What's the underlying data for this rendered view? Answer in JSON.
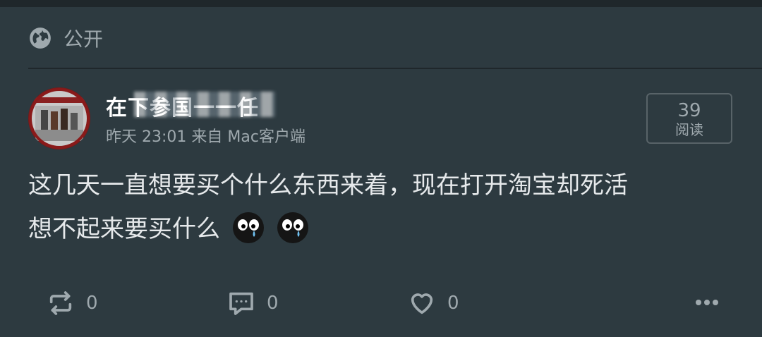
{
  "visibility": {
    "icon": "globe-icon",
    "label": "公开"
  },
  "post": {
    "author_name": "在下参国一一任",
    "meta": "昨天 23:01 来自 Mac客户端",
    "read_count": "39",
    "read_label": "阅读",
    "content_line1": "这几天一直想要买个什么东西来着，现在打开淘宝却死活",
    "content_line2": "想不起来要买什么",
    "emojis": [
      "crying-face",
      "crying-face"
    ]
  },
  "actions": {
    "repost_count": "0",
    "comment_count": "0",
    "like_count": "0"
  },
  "colors": {
    "background": "#2d3a40",
    "text_primary": "#e6e9eb",
    "text_secondary": "#9fa9ae",
    "divider": "#1f272b"
  }
}
